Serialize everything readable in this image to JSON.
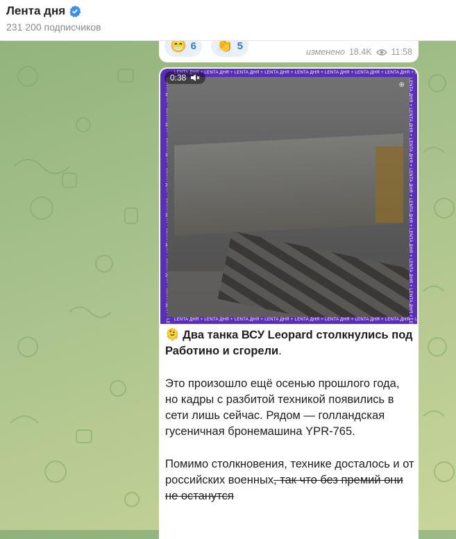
{
  "header": {
    "channel_name": "Лента дня",
    "subscribers": "231 200 подписчиков",
    "verified_icon": "verified-badge-icon"
  },
  "previous_message": {
    "reactions": [
      {
        "emoji": "😁",
        "count": "6"
      },
      {
        "emoji": "👏",
        "count": "5"
      }
    ],
    "edited_label": "изменено",
    "views": "18.4K",
    "time": "11:58"
  },
  "message": {
    "video": {
      "duration": "0:38",
      "watermark": "LENTA ДНЯ + LENTA ДНЯ + LENTA ДНЯ + LENTA ДНЯ + LENTA ДНЯ + LENTA ДНЯ + LENTA ДНЯ + LENTA ДНЯ + LENTA ДНЯ"
    },
    "emoji": "🫠",
    "title": "Два танка ВСУ Leopard столкнулись под Работино и сгорели",
    "title_period": ".",
    "paragraph1": "Это произошло ещё осенью прошлого года, но кадры с разбитой техникой появились в сети лишь сейчас. Рядом — голландская гусеничная бронемашина YPR-765.",
    "paragraph2_main": "Помимо столкновения, технике досталось и от российских военных",
    "paragraph2_strike": ", так что без премий они не останутся"
  },
  "colors": {
    "accent": "#3a7ac0",
    "video_frame": "#5a2fb8",
    "bubble": "#ffffff"
  }
}
